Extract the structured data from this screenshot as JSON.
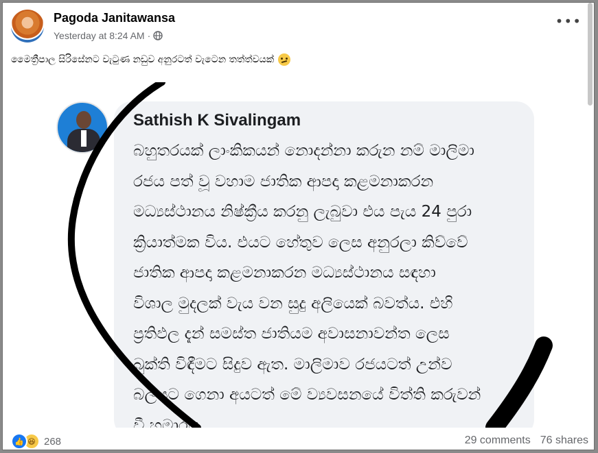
{
  "post": {
    "author": "Pagoda Janitawansa",
    "time": "Yesterday at 8:24 AM",
    "separator": "·",
    "privacy_icon": "globe-icon",
    "menu_icon": "more-options-icon",
    "caption": "මෛත්‍රීපාල සිරිසේනට වැටුණ නඩුව අනුරටත් වැටෙන තත්ත්වයක්",
    "caption_emoji": "thinking-face-icon"
  },
  "image": {
    "commenter": "Sathish K Sivalingam",
    "comment_lines": [
      "බහුතරයක් ලාංකිකයන් නොදන්නා කරුන නම් මාලිමා",
      "රජය පත් වූ වහාම ජාතික ආපදා කළමනාකරන",
      "මධ්‍යස්ථානය නිෂ්ක්‍රීය කරනු ලැබුවා එය පැය 24 පුරා",
      "ක්‍රියාත්මක විය. එයට හේතුව ලෙස අනුරලා කිව්වේ",
      "ජාතික ආපදා කළමනාකරන මධ්‍යස්ථානය සඳහා",
      "විශාල මුදලක් වැය වන සුදු අලියෙක් බවත්ය. එහි",
      "ප්‍රතිඵල දැන් සමස්ත ජාතියම අවාසනාවන්ත ලෙස",
      "බුක්ති විඳීමට සිදුව ඇත. මාලිමාව රජයටත් උන්ව",
      "බලයට ගෙනා අයටත් මේ  ව්‍යවසනයේ විත්ති කරුවන්",
      "වී හමාරය"
    ],
    "colors": {
      "bubble": "#f0f2f5",
      "scribble": "#000000"
    }
  },
  "footer": {
    "reaction_icons": [
      "like-icon",
      "haha-icon"
    ],
    "reaction_count": "268",
    "comments": "29 comments",
    "shares": "76 shares"
  }
}
